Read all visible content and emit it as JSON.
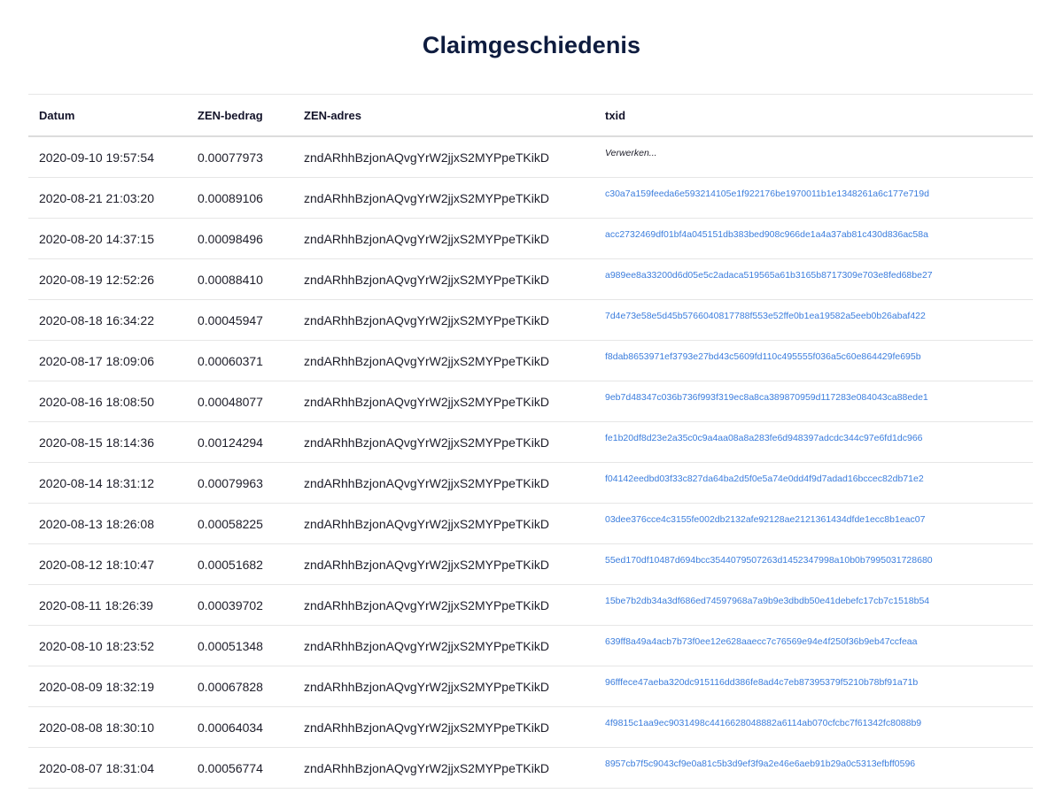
{
  "page": {
    "title": "Claimgeschiedenis"
  },
  "table": {
    "headers": {
      "date": "Datum",
      "amount": "ZEN-bedrag",
      "address": "ZEN-adres",
      "txid": "txid"
    },
    "rows": [
      {
        "date": "2020-09-10 19:57:54",
        "amount": "0.00077973",
        "address": "zndARhhBzjonAQvgYrW2jjxS2MYPpeTKikD",
        "txid": "Verwerken...",
        "pending": true
      },
      {
        "date": "2020-08-21 21:03:20",
        "amount": "0.00089106",
        "address": "zndARhhBzjonAQvgYrW2jjxS2MYPpeTKikD",
        "txid": "c30a7a159feeda6e593214105e1f922176be1970011b1e1348261a6c177e719d"
      },
      {
        "date": "2020-08-20 14:37:15",
        "amount": "0.00098496",
        "address": "zndARhhBzjonAQvgYrW2jjxS2MYPpeTKikD",
        "txid": "acc2732469df01bf4a045151db383bed908c966de1a4a37ab81c430d836ac58a"
      },
      {
        "date": "2020-08-19 12:52:26",
        "amount": "0.00088410",
        "address": "zndARhhBzjonAQvgYrW2jjxS2MYPpeTKikD",
        "txid": "a989ee8a33200d6d05e5c2adaca519565a61b3165b8717309e703e8fed68be27"
      },
      {
        "date": "2020-08-18 16:34:22",
        "amount": "0.00045947",
        "address": "zndARhhBzjonAQvgYrW2jjxS2MYPpeTKikD",
        "txid": "7d4e73e58e5d45b5766040817788f553e52ffe0b1ea19582a5eeb0b26abaf422"
      },
      {
        "date": "2020-08-17 18:09:06",
        "amount": "0.00060371",
        "address": "zndARhhBzjonAQvgYrW2jjxS2MYPpeTKikD",
        "txid": "f8dab8653971ef3793e27bd43c5609fd110c495555f036a5c60e864429fe695b"
      },
      {
        "date": "2020-08-16 18:08:50",
        "amount": "0.00048077",
        "address": "zndARhhBzjonAQvgYrW2jjxS2MYPpeTKikD",
        "txid": "9eb7d48347c036b736f993f319ec8a8ca389870959d117283e084043ca88ede1"
      },
      {
        "date": "2020-08-15 18:14:36",
        "amount": "0.00124294",
        "address": "zndARhhBzjonAQvgYrW2jjxS2MYPpeTKikD",
        "txid": "fe1b20df8d23e2a35c0c9a4aa08a8a283fe6d948397adcdc344c97e6fd1dc966"
      },
      {
        "date": "2020-08-14 18:31:12",
        "amount": "0.00079963",
        "address": "zndARhhBzjonAQvgYrW2jjxS2MYPpeTKikD",
        "txid": "f04142eedbd03f33c827da64ba2d5f0e5a74e0dd4f9d7adad16bccec82db71e2"
      },
      {
        "date": "2020-08-13 18:26:08",
        "amount": "0.00058225",
        "address": "zndARhhBzjonAQvgYrW2jjxS2MYPpeTKikD",
        "txid": "03dee376cce4c3155fe002db2132afe92128ae2121361434dfde1ecc8b1eac07"
      },
      {
        "date": "2020-08-12 18:10:47",
        "amount": "0.00051682",
        "address": "zndARhhBzjonAQvgYrW2jjxS2MYPpeTKikD",
        "txid": "55ed170df10487d694bcc3544079507263d1452347998a10b0b7995031728680"
      },
      {
        "date": "2020-08-11 18:26:39",
        "amount": "0.00039702",
        "address": "zndARhhBzjonAQvgYrW2jjxS2MYPpeTKikD",
        "txid": "15be7b2db34a3df686ed74597968a7a9b9e3dbdb50e41debefc17cb7c1518b54"
      },
      {
        "date": "2020-08-10 18:23:52",
        "amount": "0.00051348",
        "address": "zndARhhBzjonAQvgYrW2jjxS2MYPpeTKikD",
        "txid": "639ff8a49a4acb7b73f0ee12e628aaecc7c76569e94e4f250f36b9eb47ccfeaa"
      },
      {
        "date": "2020-08-09 18:32:19",
        "amount": "0.00067828",
        "address": "zndARhhBzjonAQvgYrW2jjxS2MYPpeTKikD",
        "txid": "96fffece47aeba320dc915116dd386fe8ad4c7eb87395379f5210b78bf91a71b"
      },
      {
        "date": "2020-08-08 18:30:10",
        "amount": "0.00064034",
        "address": "zndARhhBzjonAQvgYrW2jjxS2MYPpeTKikD",
        "txid": "4f9815c1aa9ec9031498c4416628048882a6114ab070cfcbc7f61342fc8088b9"
      },
      {
        "date": "2020-08-07 18:31:04",
        "amount": "0.00056774",
        "address": "zndARhhBzjonAQvgYrW2jjxS2MYPpeTKikD",
        "txid": "8957cb7f5c9043cf9e0a81c5b3d9ef3f9a2e46e6aeb91b29a0c5313efbff0596"
      }
    ]
  },
  "colors": {
    "title": "#0e1c3f",
    "link": "#3b7ddd",
    "border": "#e6e6e6"
  }
}
